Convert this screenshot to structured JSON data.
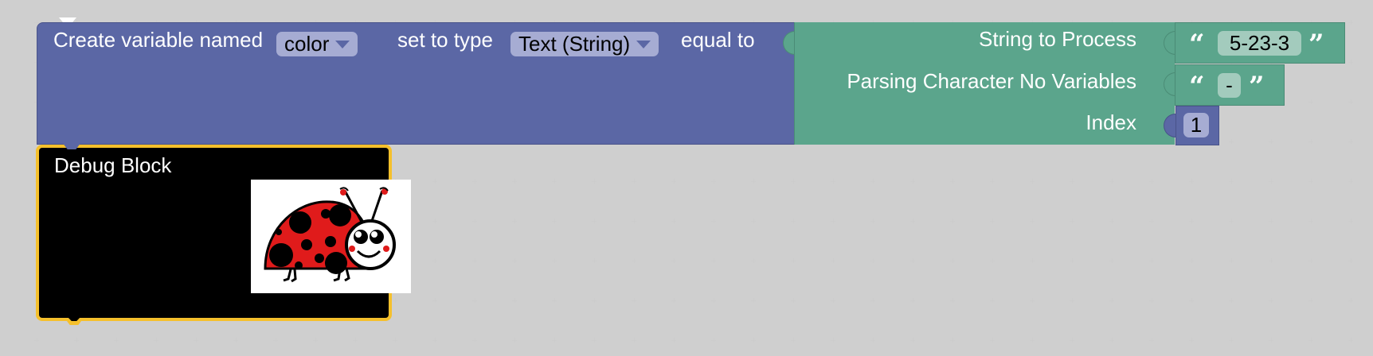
{
  "variable_block": {
    "prefix": "Create variable named",
    "name_value": "color",
    "middle": "set to type",
    "type_value": "Text (String)",
    "suffix": "equal to"
  },
  "parse_block": {
    "string_label": "String to Process",
    "parsing_label": "Parsing Character No Variables",
    "index_label": "Index"
  },
  "string_input": {
    "value": "5-23-3"
  },
  "parsing_input": {
    "value": "-"
  },
  "index_input": {
    "value": "1"
  },
  "quotes": {
    "open": "“",
    "close": "”"
  },
  "debug_block": {
    "label": "Debug Block",
    "image": "ladybug-image"
  },
  "colors": {
    "variable_block": "#5b67a5",
    "text_block": "#5ba58c",
    "debug_block": "#000000",
    "debug_border": "#f5c02c"
  }
}
